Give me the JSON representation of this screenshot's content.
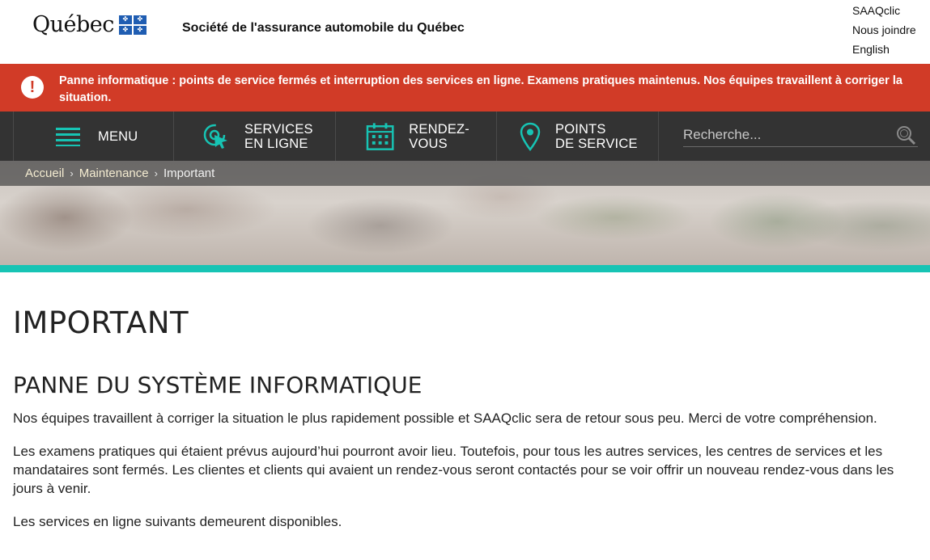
{
  "header": {
    "logo_text": "Québec",
    "org_name": "Société de l'assurance automobile du Québec",
    "utility_links": [
      "SAAQclic",
      "Nous joindre",
      "English"
    ]
  },
  "alert": {
    "icon": "exclamation-icon",
    "text": "Panne informatique : points de service fermés et interruption des services en ligne. Examens pratiques maintenus. Nos équipes travaillent à corriger la situation."
  },
  "nav": {
    "menu": {
      "label": "MENU",
      "icon": "hamburger-icon"
    },
    "services": {
      "line1": "SERVICES",
      "line2": "EN LIGNE",
      "icon": "cursor-click-icon"
    },
    "rdv": {
      "line1": "RENDEZ-",
      "line2": "VOUS",
      "icon": "calendar-icon"
    },
    "points": {
      "line1": "POINTS",
      "line2": "DE SERVICE",
      "icon": "location-pin-icon"
    },
    "search": {
      "placeholder": "Recherche...",
      "icon": "search-icon"
    }
  },
  "breadcrumb": {
    "items": [
      "Accueil",
      "Maintenance"
    ],
    "current": "Important",
    "separator": "›"
  },
  "main": {
    "title": "IMPORTANT",
    "section_title": "PANNE DU SYSTÈME INFORMATIQUE",
    "paragraphs": [
      "Nos équipes travaillent à corriger la situation le plus rapidement possible et SAAQclic sera de retour sous peu. Merci de votre compréhension.",
      "Les examens pratiques qui étaient prévus aujourd’hui pourront avoir lieu. Toutefois, pour tous les autres services, les centres de services et les mandataires sont fermés. Les clientes et clients qui avaient un rendez-vous seront contactés pour se voir offrir un nouveau rendez-vous dans les jours à venir.",
      "Les services en ligne suivants demeurent disponibles."
    ]
  },
  "colors": {
    "alert_red": "#d13b27",
    "nav_dark": "#333333",
    "accent_teal": "#17c4b4",
    "flag_blue": "#1f5db2"
  }
}
